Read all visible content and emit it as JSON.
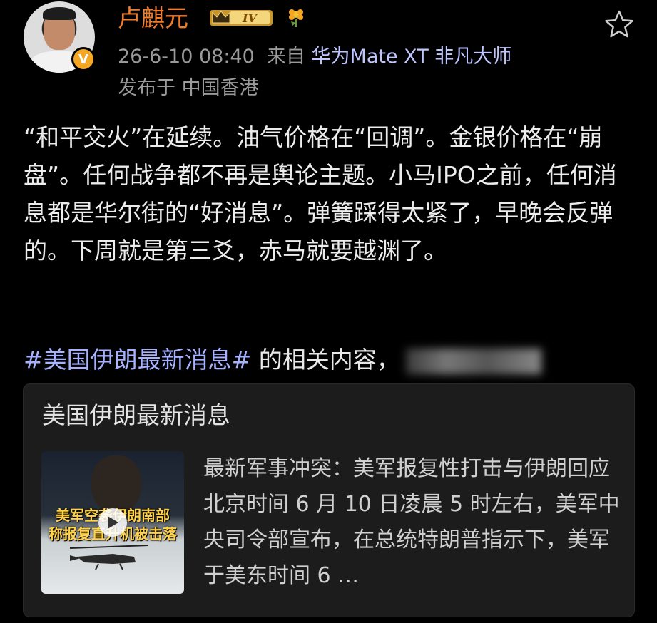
{
  "post": {
    "username": "卢麒元",
    "level": "IV",
    "timestamp": "26-6-10 08:40",
    "source_prefix": "来自",
    "device": "华为Mate XT 非凡大师",
    "location": "发布于 中国香港",
    "content": "“和平交火”在延续。油气价格在“回调”。金银价格在“崩盘”。任何战争都不再是舆论主题。小马IPO之前，任何消息都是华尔街的“好消息”。弹簧踩得太紧了，早晚会反弹的。下周就是第三爻，赤马就要越渊了。",
    "topic": "#美国伊朗最新消息#",
    "topic_suffix": " 的相关内容，"
  },
  "card": {
    "title": "美国伊朗最新消息",
    "thumbnail_caption_1": "美军空袭伊朗南部",
    "thumbnail_caption_2": "称报复直升机被击落",
    "summary": "最新军事冲突：美军报复性打击与伊朗回应北京时间 6 月 10 日凌晨 5 时左右，美军中央司令部宣布，在总统特朗普指示下，美军于美东时间 6 …"
  },
  "colors": {
    "background": "#000000",
    "username": "#f27c2a",
    "topic": "#a6b2ff",
    "device": "#bfc6ff",
    "card": "#1c1c1c"
  },
  "icons": [
    "verified-badge-icon",
    "level-crown-icon",
    "flower-icon",
    "star-icon",
    "play-icon"
  ]
}
